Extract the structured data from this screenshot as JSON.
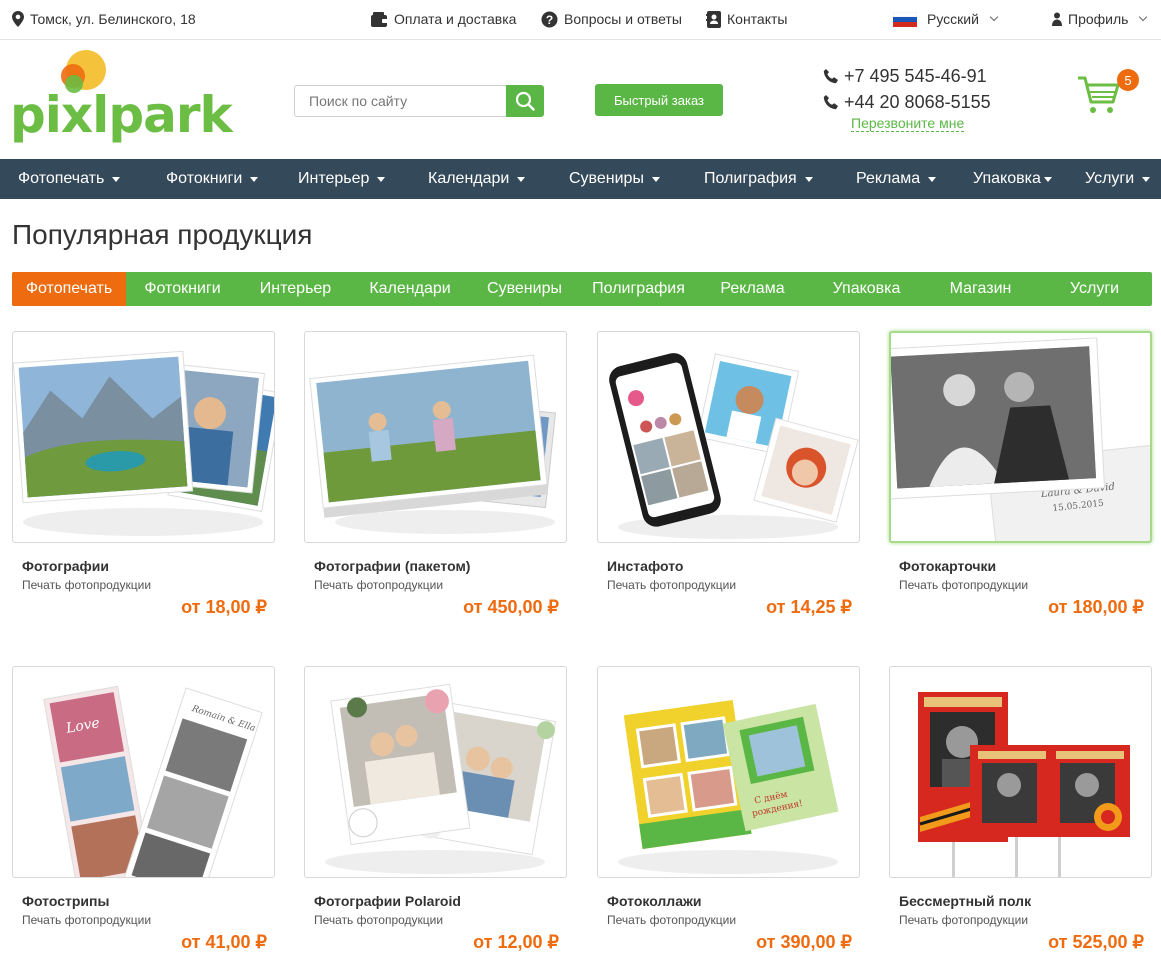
{
  "topbar": {
    "address": "Томск, ул. Белинского, 18",
    "payment": "Оплата и доставка",
    "faq": "Вопросы и ответы",
    "contacts": "Контакты",
    "language": "Русский",
    "profile": "Профиль"
  },
  "header": {
    "logo": "pixlpark",
    "search_placeholder": "Поиск по сайту",
    "quick_order": "Быстрый заказ",
    "phone1": "+7 495 545-46-91",
    "phone2": "+44 20 8068-5155",
    "callback": "Перезвоните мне",
    "cart_count": "5"
  },
  "mainnav": [
    "Фотопечать",
    "Фотокниги",
    "Интерьер",
    "Календари",
    "Сувениры",
    "Полиграфия",
    "Реклама",
    "Упаковка",
    "Услуги"
  ],
  "page_title": "Популярная продукция",
  "tabs": [
    "Фотопечать",
    "Фотокниги",
    "Интерьер",
    "Календари",
    "Сувениры",
    "Полиграфия",
    "Реклама",
    "Упаковка",
    "Магазин",
    "Услуги"
  ],
  "products": [
    {
      "title": "Фотографии",
      "sub": "Печать фотопродукции",
      "price": "от 18,00 ₽"
    },
    {
      "title": "Фотографии (пакетом)",
      "sub": "Печать фотопродукции",
      "price": "от 450,00 ₽"
    },
    {
      "title": "Инстафото",
      "sub": "Печать фотопродукции",
      "price": "от 14,25 ₽"
    },
    {
      "title": "Фотокарточки",
      "sub": "Печать фотопродукции",
      "price": "от 180,00 ₽"
    },
    {
      "title": "Фотострипы",
      "sub": "Печать фотопродукции",
      "price": "от 41,00 ₽"
    },
    {
      "title": "Фотографии Polaroid",
      "sub": "Печать фотопродукции",
      "price": "от 12,00 ₽"
    },
    {
      "title": "Фотоколлажи",
      "sub": "Печать фотопродукции",
      "price": "от 390,00 ₽"
    },
    {
      "title": "Бессмертный полк",
      "sub": "Печать фотопродукции",
      "price": "от 525,00 ₽"
    }
  ],
  "colors": {
    "accent_green": "#5bb745",
    "accent_orange": "#ee6b0f",
    "nav_bg": "#34495a"
  }
}
